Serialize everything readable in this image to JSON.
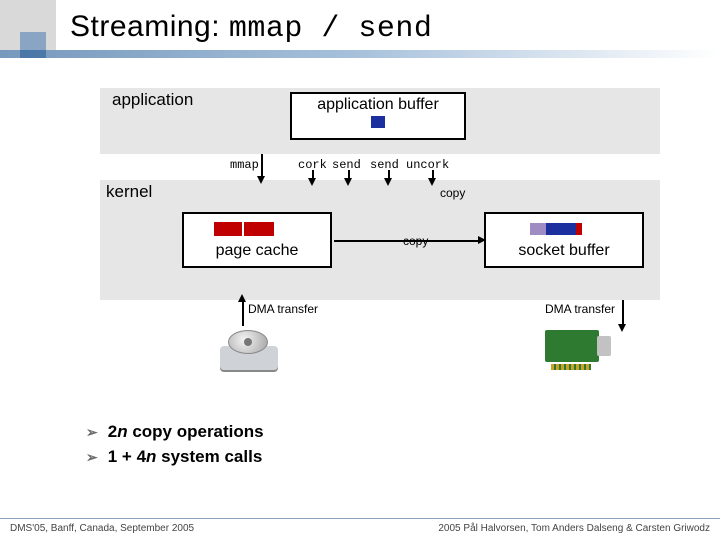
{
  "title": {
    "plain": "Streaming: ",
    "mono": "mmap / send"
  },
  "layers": {
    "application": "application",
    "kernel": "kernel"
  },
  "app_buffer": "application buffer",
  "syscalls": {
    "mmap": "mmap",
    "cork": "cork",
    "send1": "send",
    "send2": "send",
    "uncork": "uncork"
  },
  "page_cache": "page cache",
  "socket_buffer": "socket buffer",
  "labels": {
    "copy": "copy",
    "dma": "DMA transfer"
  },
  "bullets": {
    "b1_prefix": "2",
    "b1_var": "n",
    "b1_rest": " copy operations",
    "b2_prefix": "1 + 4",
    "b2_var": "n",
    "b2_rest": " system calls"
  },
  "footer": {
    "left": "DMS'05, Banff, Canada, September 2005",
    "right": "2005  Pål Halvorsen, Tom Anders Dalseng & Carsten Griwodz"
  },
  "colors": {
    "red": "#c00000",
    "blue": "#1b2f9e",
    "purple": "#9e8cc2",
    "green": "#2e7a31"
  }
}
